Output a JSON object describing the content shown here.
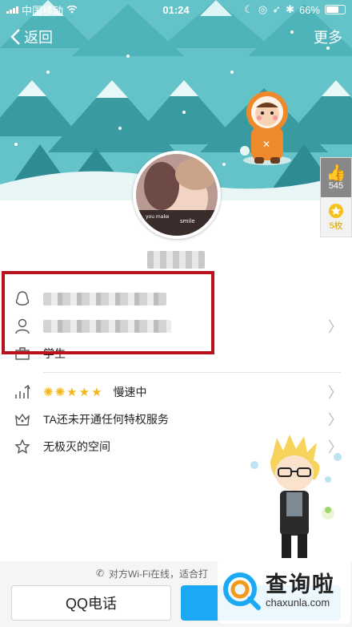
{
  "status_bar": {
    "carrier": "中国移动",
    "time": "01:24",
    "battery": "66%",
    "battery_level": 0.66
  },
  "nav": {
    "back_label": "返回",
    "more_label": "更多"
  },
  "likes": {
    "like_count": "545",
    "badge_count": "5枚"
  },
  "profile": {
    "nickname": "",
    "info_rows": [
      {
        "icon": "qq-penguin-icon",
        "text": ""
      },
      {
        "icon": "user-icon",
        "text": ""
      },
      {
        "icon": "briefcase-icon",
        "text": "学生"
      }
    ],
    "level": {
      "icon": "level-chart-icon",
      "stars": 5,
      "status": "慢速中"
    },
    "privilege": {
      "icon": "crown-icon",
      "text": "TA还未开通任何特权服务"
    },
    "space": {
      "icon": "star-outline-icon",
      "text": "无极灭的空间"
    }
  },
  "bottom": {
    "note": "对方Wi-Fi在线，适合打",
    "call_button": "QQ电话"
  },
  "watermark": {
    "cn": "查询啦",
    "en": "chaxunla.com"
  },
  "colors": {
    "accent": "#1aa9f2",
    "banner": "#5fbfc6",
    "highlight_border": "#b8131d"
  }
}
